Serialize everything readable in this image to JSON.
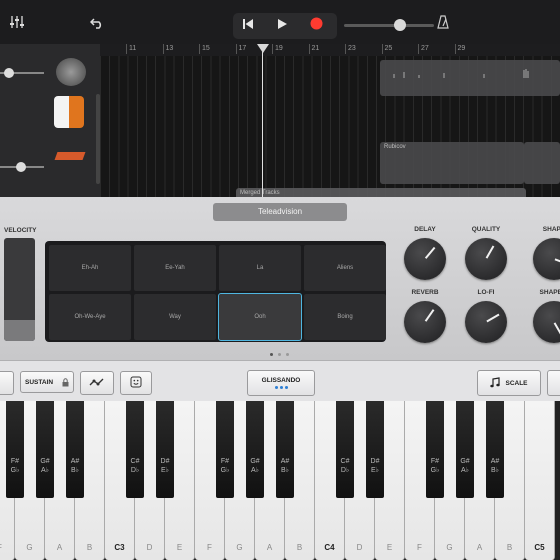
{
  "toolbar": {
    "mixer_icon": "sliders-icon",
    "undo_icon": "undo-icon",
    "rewind_icon": "rewind-icon",
    "play_icon": "play-icon",
    "record_icon": "record-icon",
    "metronome_icon": "metronome-icon",
    "record_color": "#ff3b30"
  },
  "ruler": {
    "ticks": [
      "11",
      "13",
      "15",
      "17",
      "19",
      "21",
      "23",
      "25",
      "27",
      "29"
    ]
  },
  "tracks": {
    "regions": [
      {
        "label": ""
      },
      {
        "label": "Rubicov"
      },
      {
        "label": "Merged Tracks"
      }
    ]
  },
  "instrument": {
    "patch_name": "Teleadvision",
    "velocity_label": "VELOCITY",
    "velocity_level": 0.2,
    "pads": [
      "Eh-Ah",
      "Ee-Yah",
      "La",
      "Aliens",
      "Oh-We-Aye",
      "Way",
      "Ooh",
      "Boing"
    ],
    "selected_pad": "Ooh",
    "knobs": [
      {
        "label": "DELAY"
      },
      {
        "label": "QUALITY"
      },
      {
        "label": "SHAPE"
      },
      {
        "label": "REVERB"
      },
      {
        "label": "LO-FI"
      },
      {
        "label": "SHAPE R"
      }
    ]
  },
  "controls": {
    "sustain": "SUSTAIN",
    "glissando": "GLISSANDO",
    "scale": "SCALE",
    "arpeggiator_icon": "arpeggiator-icon",
    "smiley_icon": "smiley-icon",
    "lock_icon": "lock-icon",
    "note_icon": "music-note-icon"
  },
  "keyboard": {
    "white_labels": [
      "F",
      "G",
      "A",
      "B",
      "C3",
      "D",
      "E",
      "F",
      "G",
      "A",
      "B",
      "C4",
      "D",
      "E",
      "F",
      "G",
      "A",
      "B",
      "C5"
    ],
    "black_labels": [
      [
        "F#",
        "G♭"
      ],
      [
        "G#",
        "A♭"
      ],
      [
        "A#",
        "B♭"
      ],
      [
        "C#",
        "D♭"
      ],
      [
        "D#",
        "E♭"
      ],
      [
        "F#",
        "G♭"
      ],
      [
        "G#",
        "A♭"
      ],
      [
        "A#",
        "B♭"
      ],
      [
        "C#",
        "D♭"
      ],
      [
        "D#",
        "E♭"
      ],
      [
        "F#",
        "G♭"
      ],
      [
        "G#",
        "A♭"
      ],
      [
        "A#",
        "B♭"
      ]
    ]
  }
}
